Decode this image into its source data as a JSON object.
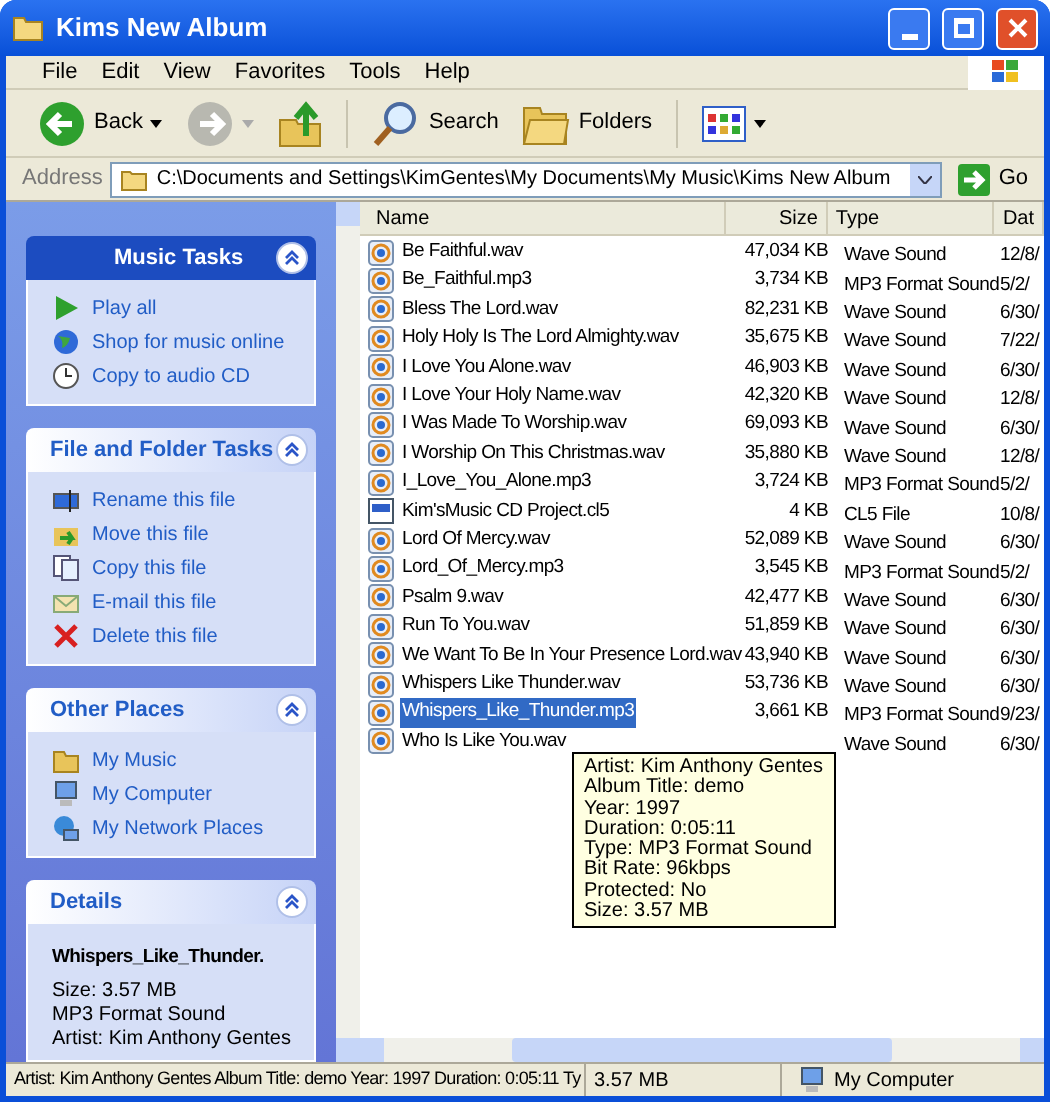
{
  "window": {
    "title": "Kims New Album"
  },
  "menu": [
    "File",
    "Edit",
    "View",
    "Favorites",
    "Tools",
    "Help"
  ],
  "toolbar": [
    {
      "kind": "back",
      "label": "Back"
    },
    {
      "kind": "forward"
    },
    {
      "kind": "up"
    },
    {
      "kind": "search",
      "label": "Search"
    },
    {
      "kind": "folders",
      "label": "Folders"
    },
    {
      "kind": "views"
    }
  ],
  "address": {
    "label": "Address",
    "value": "C:\\Documents and Settings\\KimGentes\\My Documents\\My Music\\Kims New Album",
    "go": "Go"
  },
  "panels": [
    {
      "title": "Music Tasks",
      "kind": "special",
      "items": [
        {
          "label": "Play all"
        },
        {
          "label": "Shop for music online"
        },
        {
          "label": "Copy to audio CD"
        }
      ]
    },
    {
      "title": "File and Folder Tasks",
      "kind": "plain",
      "items": [
        {
          "label": "Rename this file"
        },
        {
          "label": "Move this file"
        },
        {
          "label": "Copy this file"
        },
        {
          "label": "E-mail this file"
        },
        {
          "label": "Delete this file"
        }
      ]
    },
    {
      "title": "Other Places",
      "kind": "plain",
      "items": [
        {
          "label": "My Music"
        },
        {
          "label": "My Computer"
        },
        {
          "label": "My Network Places"
        }
      ]
    }
  ],
  "details": {
    "title": "Details",
    "name": "Whispers_Like_Thunder.",
    "lines": [
      "Size: 3.57 MB",
      "MP3 Format Sound",
      "Artist: Kim Anthony Gentes"
    ]
  },
  "columns": [
    "Name",
    "Size",
    "Type",
    "Dat"
  ],
  "rows": [
    {
      "name": "Be Faithful.wav",
      "size": "47,034 KB",
      "type": "Wave Sound",
      "date": "12/8/",
      "kind": "audio",
      "selected": false
    },
    {
      "name": "Be_Faithful.mp3",
      "size": "3,734 KB",
      "type": "MP3 Format Sound",
      "date": "5/2/",
      "kind": "audio",
      "selected": false
    },
    {
      "name": "Bless The Lord.wav",
      "size": "82,231 KB",
      "type": "Wave Sound",
      "date": "6/30/",
      "kind": "audio",
      "selected": false
    },
    {
      "name": "Holy Holy Is The Lord Almighty.wav",
      "size": "35,675 KB",
      "type": "Wave Sound",
      "date": "7/22/",
      "kind": "audio",
      "selected": false
    },
    {
      "name": "I Love You Alone.wav",
      "size": "46,903 KB",
      "type": "Wave Sound",
      "date": "6/30/",
      "kind": "audio",
      "selected": false
    },
    {
      "name": "I Love Your Holy Name.wav",
      "size": "42,320 KB",
      "type": "Wave Sound",
      "date": "12/8/",
      "kind": "audio",
      "selected": false
    },
    {
      "name": "I Was Made To Worship.wav",
      "size": "69,093 KB",
      "type": "Wave Sound",
      "date": "6/30/",
      "kind": "audio",
      "selected": false
    },
    {
      "name": "I Worship On This Christmas.wav",
      "size": "35,880 KB",
      "type": "Wave Sound",
      "date": "12/8/",
      "kind": "audio",
      "selected": false
    },
    {
      "name": "I_Love_You_Alone.mp3",
      "size": "3,724 KB",
      "type": "MP3 Format Sound",
      "date": "5/2/",
      "kind": "audio",
      "selected": false
    },
    {
      "name": "Kim'sMusic CD Project.cl5",
      "size": "4 KB",
      "type": "CL5 File",
      "date": "10/8/",
      "kind": "project",
      "selected": false
    },
    {
      "name": "Lord Of Mercy.wav",
      "size": "52,089 KB",
      "type": "Wave Sound",
      "date": "6/30/",
      "kind": "audio",
      "selected": false
    },
    {
      "name": "Lord_Of_Mercy.mp3",
      "size": "3,545 KB",
      "type": "MP3 Format Sound",
      "date": "5/2/",
      "kind": "audio",
      "selected": false
    },
    {
      "name": "Psalm 9.wav",
      "size": "42,477 KB",
      "type": "Wave Sound",
      "date": "6/30/",
      "kind": "audio",
      "selected": false
    },
    {
      "name": "Run To You.wav",
      "size": "51,859 KB",
      "type": "Wave Sound",
      "date": "6/30/",
      "kind": "audio",
      "selected": false
    },
    {
      "name": "We Want To Be In Your Presence Lord.wav",
      "size": "43,940 KB",
      "type": "Wave Sound",
      "date": "6/30/",
      "kind": "audio",
      "selected": false
    },
    {
      "name": "Whispers Like Thunder.wav",
      "size": "53,736 KB",
      "type": "Wave Sound",
      "date": "6/30/",
      "kind": "audio",
      "selected": false
    },
    {
      "name": "Whispers_Like_Thunder.mp3",
      "size": "3,661 KB",
      "type": "MP3 Format Sound",
      "date": "9/23/",
      "kind": "audio",
      "selected": true
    },
    {
      "name": "Who Is Like You.wav",
      "type": "Wave Sound",
      "date": "6/30/",
      "kind": "audio",
      "selected": false
    }
  ],
  "tooltip": [
    "Artist: Kim Anthony Gentes",
    "Album Title: demo",
    "Year: 1997",
    "Duration: 0:05:11",
    "Type: MP3 Format Sound",
    "Bit Rate: 96kbps",
    "Protected: No",
    "Size: 3.57 MB"
  ],
  "status_bar": {
    "info": "Artist: Kim Anthony Gentes Album Title: demo Year: 1997 Duration: 0:05:11 Ty",
    "size": "3.57 MB",
    "zone": "My Computer"
  }
}
